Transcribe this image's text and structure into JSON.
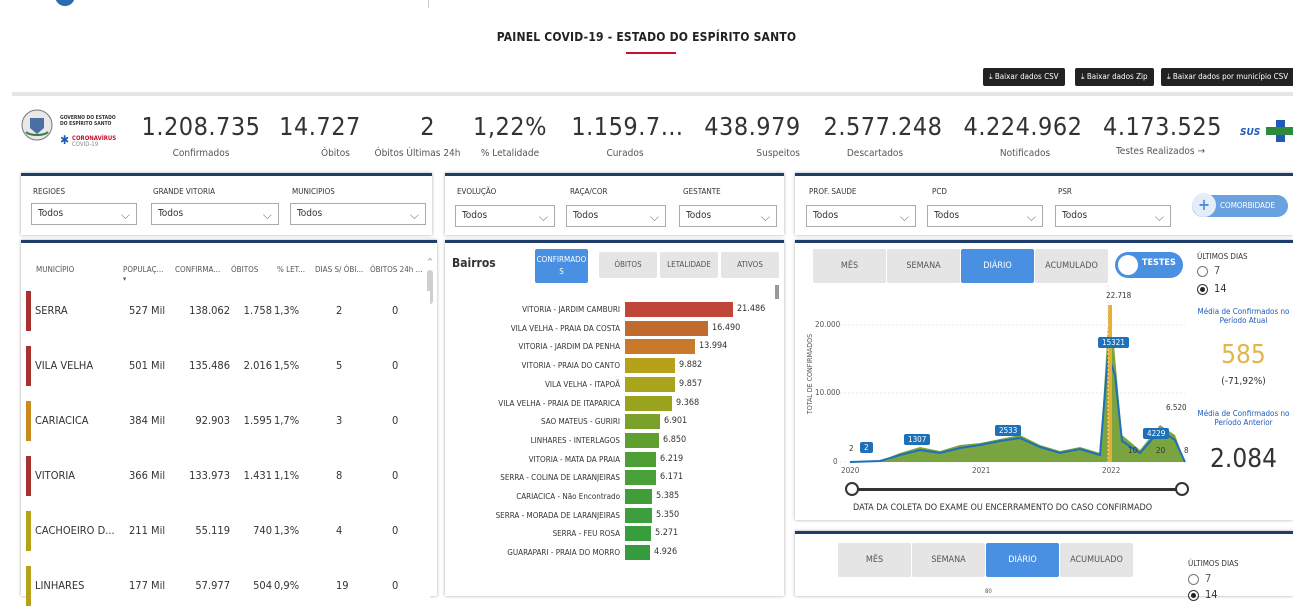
{
  "page": {
    "title": "PAINEL COVID-19 - ESTADO DO ESPÍRITO SANTO"
  },
  "downloads": [
    "⤓ Baixar dados CSV",
    "⤓ Baixar dados Zip",
    "⤓ Baixar dados por município CSV"
  ],
  "logo": {
    "gov_line1": "GOVERNO DO ESTADO",
    "gov_line2": "DO ESPÍRITO SANTO",
    "brand": "CORONAVÍRUS",
    "brand_sub": "COVID-19",
    "sus": "SUS"
  },
  "kpis": [
    {
      "value": "1.208.735",
      "label": "Confirmados"
    },
    {
      "value": "14.727",
      "label": "Óbitos"
    },
    {
      "value": "2",
      "label": "Óbitos Últimas 24h"
    },
    {
      "value": "1,22%",
      "label": "% Letalidade"
    },
    {
      "value": "1.159.7…",
      "label": "Curados"
    },
    {
      "value": "438.979",
      "label": "Suspeitos"
    },
    {
      "value": "2.577.248",
      "label": "Descartados"
    },
    {
      "value": "4.224.962",
      "label": "Notificados"
    },
    {
      "value": "4.173.525",
      "label": "Testes Realizados →"
    }
  ],
  "filters1": [
    {
      "label": "REGIOES",
      "value": "Todos"
    },
    {
      "label": "GRANDE VITORIA",
      "value": "Todos"
    },
    {
      "label": "MUNICIPIOS",
      "value": "Todos"
    }
  ],
  "filters2": [
    {
      "label": "EVOLUÇÃO",
      "value": "Todos"
    },
    {
      "label": "RAÇA/COR",
      "value": "Todos"
    },
    {
      "label": "GESTANTE",
      "value": "Todos"
    }
  ],
  "filters3": [
    {
      "label": "PROF. SAUDE",
      "value": "Todos"
    },
    {
      "label": "PCD",
      "value": "Todos"
    },
    {
      "label": "PSR",
      "value": "Todos"
    }
  ],
  "comorbidade": "COMORBIDADE",
  "table": {
    "headers": [
      "MUNICÍPIO",
      "POPULAÇ...",
      "CONFIRMA...",
      "ÓBITOS",
      "% LET...",
      "DIAS S/ ÓBI...",
      "ÓBITOS 24h ..."
    ],
    "rows": [
      {
        "mun": "SERRA",
        "pop": "527 Mil",
        "conf": "138.062",
        "obitos": "1.758",
        "let": "1,3%",
        "dias": "2",
        "ob24": "0",
        "color": "#a83232"
      },
      {
        "mun": "VILA VELHA",
        "pop": "501 Mil",
        "conf": "135.486",
        "obitos": "2.016",
        "let": "1,5%",
        "dias": "5",
        "ob24": "0",
        "color": "#a83232"
      },
      {
        "mun": "CARIACICA",
        "pop": "384 Mil",
        "conf": "92.903",
        "obitos": "1.595",
        "let": "1,7%",
        "dias": "3",
        "ob24": "0",
        "color": "#c98a1e"
      },
      {
        "mun": "VITORIA",
        "pop": "366 Mil",
        "conf": "133.973",
        "obitos": "1.431",
        "let": "1,1%",
        "dias": "8",
        "ob24": "0",
        "color": "#a83232"
      },
      {
        "mun": "CACHOEIRO D...",
        "pop": "211 Mil",
        "conf": "55.119",
        "obitos": "740",
        "let": "1,3%",
        "dias": "4",
        "ob24": "0",
        "color": "#b5a21a"
      },
      {
        "mun": "LINHARES",
        "pop": "177 Mil",
        "conf": "57.977",
        "obitos": "504",
        "let": "0,9%",
        "dias": "19",
        "ob24": "0",
        "color": "#b5a21a"
      }
    ]
  },
  "bairros": {
    "title": "Bairros",
    "tabs": [
      "CONFIRMADOS",
      "ÓBITOS",
      "LETALIDADE",
      "ATIVOS"
    ],
    "chart_data": {
      "type": "bar",
      "categories": [
        "VITORIA - JARDIM CAMBURI",
        "VILA VELHA - PRAIA DA COSTA",
        "VITORIA - JARDIM DA PENHA",
        "VITORIA - PRAIA DO CANTO",
        "VILA VELHA - ITAPOÃ",
        "VILA VELHA - PRAIA DE ITAPARICA",
        "SAO MATEUS - GURIRI",
        "LINHARES - INTERLAGOS",
        "VITORIA - MATA DA PRAIA",
        "SERRA - COLINA DE LARANJEIRAS",
        "CARIACICA - Não Encontrado",
        "SERRA - MORADA DE LARANJEIRAS",
        "SERRA - FEU ROSA",
        "GUARAPARI - PRAIA DO MORRO"
      ],
      "values": [
        21486,
        16490,
        13994,
        9882,
        9857,
        9368,
        6901,
        6850,
        6219,
        6171,
        5385,
        5350,
        5271,
        4926
      ],
      "labels": [
        "21.486",
        "16.490",
        "13.994",
        "9.882",
        "9.857",
        "9.368",
        "6.901",
        "6.850",
        "6.219",
        "6.171",
        "5.385",
        "5.350",
        "5.271",
        "4.926"
      ],
      "colors": [
        "#c0463a",
        "#c06a2e",
        "#c87a2a",
        "#b5a21a",
        "#a8a41c",
        "#9aa31e",
        "#7aa12a",
        "#5f9f30",
        "#4f9e34",
        "#48a038",
        "#3f9e3a",
        "#3c9e3c",
        "#389d3d",
        "#359c3e"
      ]
    }
  },
  "daily": {
    "tabs": [
      "MÊS",
      "SEMANA",
      "DIÁRIO",
      "ACUMULADO"
    ],
    "toggle": "TESTES",
    "ultimos": "ÚLTIMOS DIAS",
    "opt7": "7",
    "opt14": "14",
    "media_atual_label": "Média de Confirmados no Período Atual",
    "media_atual": "585",
    "variation": "(-71,92%)",
    "media_ant_label": "Média de Confirmados no Período Anterior",
    "media_ant": "2.084",
    "ylabel": "TOTAL DE CONFIRMADOS",
    "xlabel": "DATA DA COLETA DO EXAME OU ENCERRAMENTO DO CASO CONFIRMADO",
    "yticks": [
      "0",
      "10.000",
      "20.000"
    ],
    "xticks": [
      "2020",
      "2021",
      "2022"
    ],
    "annotations": [
      "22.718",
      "15321",
      "6.520",
      "4229",
      "2533",
      "1307",
      "2",
      "2",
      "10",
      "20",
      "8"
    ]
  },
  "bottom": {
    "tabs": [
      "MÊS",
      "SEMANA",
      "DIÁRIO",
      "ACUMULADO"
    ],
    "ultimos": "ÚLTIMOS DIAS",
    "opt7": "7",
    "opt14": "14",
    "tick": "80"
  }
}
